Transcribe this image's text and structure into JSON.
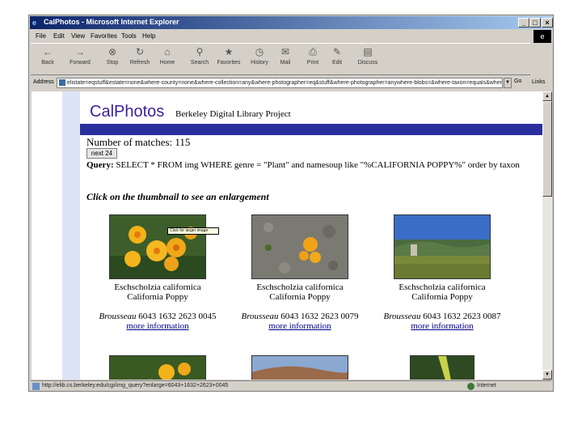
{
  "window": {
    "title": "CalPhotos - Microsoft Internet Explorer",
    "controls": {
      "minimize": "_",
      "maximize": "□",
      "close": "×"
    }
  },
  "menu": [
    "File",
    "Edit",
    "View",
    "Favorites",
    "Tools",
    "Help"
  ],
  "toolbar": [
    {
      "label": "Back",
      "icon": "back-arrow-icon"
    },
    {
      "label": "Forward",
      "icon": "forward-arrow-icon"
    },
    {
      "label": "Stop",
      "icon": "stop-icon"
    },
    {
      "label": "Refresh",
      "icon": "refresh-icon"
    },
    {
      "label": "Home",
      "icon": "home-icon"
    },
    {
      "label": "Search",
      "icon": "search-icon"
    },
    {
      "label": "Favorites",
      "icon": "favorites-icon"
    },
    {
      "label": "History",
      "icon": "history-icon"
    },
    {
      "label": "Mail",
      "icon": "mail-icon"
    },
    {
      "label": "Print",
      "icon": "print-icon"
    },
    {
      "label": "Edit",
      "icon": "edit-icon"
    },
    {
      "label": "Discuss",
      "icon": "discuss-icon"
    }
  ],
  "address": {
    "label": "Address",
    "url": "elistate=eqstuff&estate=none&where-county=none&where-collection=any&where-photographer=eq&stuff&where-photographer=anywhere-blobs=&where-taxon=equals&where-loc=",
    "go": "Go",
    "links": "Links"
  },
  "status": {
    "text": "http://elib.cs.berkeley.edu/cgi/img_query?enlarge=6043+1632+2623+0045",
    "zone": "Internet"
  },
  "page": {
    "logo": "CalPhotos",
    "subtitle": "Berkeley Digital Library Project",
    "matches_label": "Number of matches:",
    "matches_value": " 115",
    "next_button": "next 24",
    "query_label": "Query:",
    "query_text": " SELECT * FROM img WHERE genre = \"Plant\" and namesoup like \"%CALIFORNIA POPPY%\" order by taxon",
    "instruction": "Click on the thumbnail to see an enlargement",
    "tooltip": "Click for larger image",
    "cards": [
      {
        "sci": "Eschscholzia californica",
        "common": "California Poppy",
        "photographer": "Brousseau",
        "id": " 6043 1632 2623 0045",
        "more": "more information"
      },
      {
        "sci": "Eschscholzia californica",
        "common": "California Poppy",
        "photographer": "Brousseau",
        "id": " 6043 1632 2623 0079",
        "more": "more information"
      },
      {
        "sci": "Eschscholzia californica",
        "common": "California Poppy",
        "photographer": "Brousseau",
        "id": " 6043 1632 2623 0087",
        "more": "more information"
      }
    ]
  },
  "colors": {
    "accent_band": "#2b2f9e",
    "logo": "#3a1f9e",
    "link": "#00008b",
    "sidebar": "#dde3f7"
  }
}
